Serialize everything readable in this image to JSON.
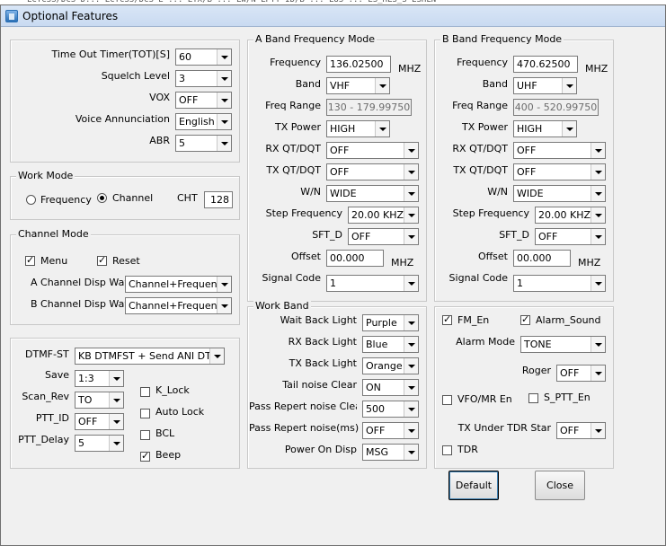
{
  "background_strip": "  LCTCSS/DCS D... LCTCSS/DCS E ... LTX/B ...  LW/N LPTT ID/B ... LUS ... LS_HLS_S LSHLN",
  "window": {
    "title": "Optional Features"
  },
  "general": {
    "tot_label": "Time Out Timer(TOT)[S]",
    "tot_value": "60",
    "squelch_label": "Squelch Level",
    "squelch_value": "3",
    "vox_label": "VOX",
    "vox_value": "OFF",
    "voice_label": "Voice Annunciation",
    "voice_value": "English",
    "abr_label": "ABR",
    "abr_value": "5"
  },
  "work_mode": {
    "title": "Work Mode",
    "frequency_label": "Frequency",
    "channel_label": "Channel",
    "selected": "Channel",
    "cht_label": "CHT",
    "cht_value": "128"
  },
  "channel_mode": {
    "title": "Channel Mode",
    "menu_label": "Menu",
    "menu_checked": true,
    "reset_label": "Reset",
    "reset_checked": true,
    "a_disp_label": "A Channel Disp Way",
    "a_disp_value": "Channel+Frequency",
    "b_disp_label": "B Channel Disp Way",
    "b_disp_value": "Channel+Frequency"
  },
  "dtmf": {
    "dtmf_st_label": "DTMF-ST",
    "dtmf_st_value": "KB DTMFST + Send ANI DTM",
    "save_label": "Save",
    "save_value": "1:3",
    "scan_rev_label": "Scan_Rev",
    "scan_rev_value": "TO",
    "ptt_id_label": "PTT_ID",
    "ptt_id_value": "OFF",
    "ptt_delay_label": "PTT_Delay",
    "ptt_delay_value": "5",
    "k_lock_label": "K_Lock",
    "k_lock_checked": false,
    "auto_lock_label": "Auto Lock",
    "auto_lock_checked": false,
    "bcl_label": "BCL",
    "bcl_checked": false,
    "beep_label": "Beep",
    "beep_checked": true
  },
  "a_band": {
    "title": "A Band Frequency Mode",
    "frequency_label": "Frequency",
    "frequency_value": "136.02500",
    "unit": "MHZ",
    "band_label": "Band",
    "band_value": "VHF",
    "range_label": "Freq Range",
    "range_value": "130 - 179.99750",
    "tx_power_label": "TX Power",
    "tx_power_value": "HIGH",
    "rx_qt_label": "RX QT/DQT",
    "rx_qt_value": "OFF",
    "tx_qt_label": "TX QT/DQT",
    "tx_qt_value": "OFF",
    "wn_label": "W/N",
    "wn_value": "WIDE",
    "step_label": "Step Frequency",
    "step_value": "20.00 KHZ",
    "sft_label": "SFT_D",
    "sft_value": "OFF",
    "offset_label": "Offset",
    "offset_value": "00.000",
    "offset_unit": "MHZ",
    "signal_label": "Signal Code",
    "signal_value": "1"
  },
  "b_band": {
    "title": "B Band Frequency Mode",
    "frequency_label": "Frequency",
    "frequency_value": "470.62500",
    "unit": "MHZ",
    "band_label": "Band",
    "band_value": "UHF",
    "range_label": "Freq Range",
    "range_value": "400 - 520.99750",
    "tx_power_label": "TX Power",
    "tx_power_value": "HIGH",
    "rx_qt_label": "RX QT/DQT",
    "rx_qt_value": "OFF",
    "tx_qt_label": "TX QT/DQT",
    "tx_qt_value": "OFF",
    "wn_label": "W/N",
    "wn_value": "WIDE",
    "step_label": "Step Frequency",
    "step_value": "20.00 KHZ",
    "sft_label": "SFT_D",
    "sft_value": "OFF",
    "offset_label": "Offset",
    "offset_value": "00.000",
    "offset_unit": "MHZ",
    "signal_label": "Signal Code",
    "signal_value": "1"
  },
  "work_band": {
    "title": "Work Band",
    "wait_label": "Wait Back Light",
    "wait_value": "Purple",
    "rx_label": "RX Back Light",
    "rx_value": "Blue",
    "tx_label": "TX Back Light",
    "tx_value": "Orange",
    "tail_label": "Tail noise Clear",
    "tail_value": "ON",
    "repert_label": "Pass Repert noise Clear",
    "repert_value": "500",
    "repert_ms_label": "Pass Repert noise(ms)",
    "repert_ms_value": "OFF",
    "poweron_label": "Power On Disp",
    "poweron_value": "MSG"
  },
  "extra": {
    "fm_en_label": "FM_En",
    "fm_en_checked": true,
    "alarm_sound_label": "Alarm_Sound",
    "alarm_sound_checked": true,
    "alarm_mode_label": "Alarm Mode",
    "alarm_mode_value": "TONE",
    "roger_label": "Roger",
    "roger_value": "OFF",
    "vfo_label": "VFO/MR En",
    "vfo_checked": false,
    "sptt_label": "S_PTT_En",
    "sptt_checked": false,
    "tdr_star_label": "TX Under TDR Star",
    "tdr_star_value": "OFF",
    "tdr_label": "TDR",
    "tdr_checked": false
  },
  "buttons": {
    "default_label": "Default",
    "close_label": "Close"
  }
}
